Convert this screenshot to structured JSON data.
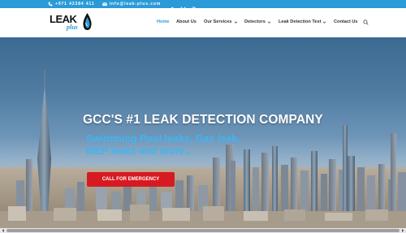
{
  "topbar": {
    "background": "#2b9bd8",
    "phone": {
      "icon": "phone-icon",
      "text": "+971 42384 411"
    },
    "email": {
      "icon": "envelope-icon",
      "text": "info@leak-plus.com"
    },
    "social": [
      "facebook-icon",
      "x-twitter-icon",
      "rss-icon"
    ]
  },
  "logo": {
    "word": "LEAK",
    "sub": "plus",
    "icon": "water-drop-icon"
  },
  "nav": {
    "items": [
      {
        "label": "Home",
        "active": true,
        "dropdown": false
      },
      {
        "label": "About Us",
        "active": false,
        "dropdown": false
      },
      {
        "label": "Our Services",
        "active": false,
        "dropdown": true
      },
      {
        "label": "Detectors",
        "active": false,
        "dropdown": true
      },
      {
        "label": "Leak Detection Test",
        "active": false,
        "dropdown": true
      },
      {
        "label": "Contact Us",
        "active": false,
        "dropdown": false
      }
    ],
    "search_icon": "search-icon",
    "active_color": "#2b9bd8"
  },
  "hero": {
    "title": "GCC'S #1 LEAK DETECTION COMPANY",
    "subtitle_line1": "Swimming Pool leaks, Gas leak,",
    "subtitle_line2": "MEP leaks and more..",
    "subtitle_color": "#43b4ee",
    "cta_label": "CALL FOR EMERGENCY",
    "cta_color": "#d71a21"
  }
}
